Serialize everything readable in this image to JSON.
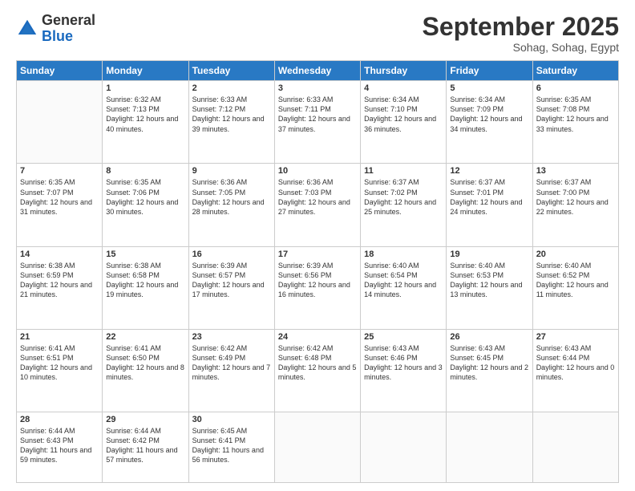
{
  "header": {
    "logo_general": "General",
    "logo_blue": "Blue",
    "month_title": "September 2025",
    "location": "Sohag, Sohag, Egypt"
  },
  "days_of_week": [
    "Sunday",
    "Monday",
    "Tuesday",
    "Wednesday",
    "Thursday",
    "Friday",
    "Saturday"
  ],
  "weeks": [
    [
      {
        "day": "",
        "sunrise": "",
        "sunset": "",
        "daylight": ""
      },
      {
        "day": "1",
        "sunrise": "Sunrise: 6:32 AM",
        "sunset": "Sunset: 7:13 PM",
        "daylight": "Daylight: 12 hours and 40 minutes."
      },
      {
        "day": "2",
        "sunrise": "Sunrise: 6:33 AM",
        "sunset": "Sunset: 7:12 PM",
        "daylight": "Daylight: 12 hours and 39 minutes."
      },
      {
        "day": "3",
        "sunrise": "Sunrise: 6:33 AM",
        "sunset": "Sunset: 7:11 PM",
        "daylight": "Daylight: 12 hours and 37 minutes."
      },
      {
        "day": "4",
        "sunrise": "Sunrise: 6:34 AM",
        "sunset": "Sunset: 7:10 PM",
        "daylight": "Daylight: 12 hours and 36 minutes."
      },
      {
        "day": "5",
        "sunrise": "Sunrise: 6:34 AM",
        "sunset": "Sunset: 7:09 PM",
        "daylight": "Daylight: 12 hours and 34 minutes."
      },
      {
        "day": "6",
        "sunrise": "Sunrise: 6:35 AM",
        "sunset": "Sunset: 7:08 PM",
        "daylight": "Daylight: 12 hours and 33 minutes."
      }
    ],
    [
      {
        "day": "7",
        "sunrise": "Sunrise: 6:35 AM",
        "sunset": "Sunset: 7:07 PM",
        "daylight": "Daylight: 12 hours and 31 minutes."
      },
      {
        "day": "8",
        "sunrise": "Sunrise: 6:35 AM",
        "sunset": "Sunset: 7:06 PM",
        "daylight": "Daylight: 12 hours and 30 minutes."
      },
      {
        "day": "9",
        "sunrise": "Sunrise: 6:36 AM",
        "sunset": "Sunset: 7:05 PM",
        "daylight": "Daylight: 12 hours and 28 minutes."
      },
      {
        "day": "10",
        "sunrise": "Sunrise: 6:36 AM",
        "sunset": "Sunset: 7:03 PM",
        "daylight": "Daylight: 12 hours and 27 minutes."
      },
      {
        "day": "11",
        "sunrise": "Sunrise: 6:37 AM",
        "sunset": "Sunset: 7:02 PM",
        "daylight": "Daylight: 12 hours and 25 minutes."
      },
      {
        "day": "12",
        "sunrise": "Sunrise: 6:37 AM",
        "sunset": "Sunset: 7:01 PM",
        "daylight": "Daylight: 12 hours and 24 minutes."
      },
      {
        "day": "13",
        "sunrise": "Sunrise: 6:37 AM",
        "sunset": "Sunset: 7:00 PM",
        "daylight": "Daylight: 12 hours and 22 minutes."
      }
    ],
    [
      {
        "day": "14",
        "sunrise": "Sunrise: 6:38 AM",
        "sunset": "Sunset: 6:59 PM",
        "daylight": "Daylight: 12 hours and 21 minutes."
      },
      {
        "day": "15",
        "sunrise": "Sunrise: 6:38 AM",
        "sunset": "Sunset: 6:58 PM",
        "daylight": "Daylight: 12 hours and 19 minutes."
      },
      {
        "day": "16",
        "sunrise": "Sunrise: 6:39 AM",
        "sunset": "Sunset: 6:57 PM",
        "daylight": "Daylight: 12 hours and 17 minutes."
      },
      {
        "day": "17",
        "sunrise": "Sunrise: 6:39 AM",
        "sunset": "Sunset: 6:56 PM",
        "daylight": "Daylight: 12 hours and 16 minutes."
      },
      {
        "day": "18",
        "sunrise": "Sunrise: 6:40 AM",
        "sunset": "Sunset: 6:54 PM",
        "daylight": "Daylight: 12 hours and 14 minutes."
      },
      {
        "day": "19",
        "sunrise": "Sunrise: 6:40 AM",
        "sunset": "Sunset: 6:53 PM",
        "daylight": "Daylight: 12 hours and 13 minutes."
      },
      {
        "day": "20",
        "sunrise": "Sunrise: 6:40 AM",
        "sunset": "Sunset: 6:52 PM",
        "daylight": "Daylight: 12 hours and 11 minutes."
      }
    ],
    [
      {
        "day": "21",
        "sunrise": "Sunrise: 6:41 AM",
        "sunset": "Sunset: 6:51 PM",
        "daylight": "Daylight: 12 hours and 10 minutes."
      },
      {
        "day": "22",
        "sunrise": "Sunrise: 6:41 AM",
        "sunset": "Sunset: 6:50 PM",
        "daylight": "Daylight: 12 hours and 8 minutes."
      },
      {
        "day": "23",
        "sunrise": "Sunrise: 6:42 AM",
        "sunset": "Sunset: 6:49 PM",
        "daylight": "Daylight: 12 hours and 7 minutes."
      },
      {
        "day": "24",
        "sunrise": "Sunrise: 6:42 AM",
        "sunset": "Sunset: 6:48 PM",
        "daylight": "Daylight: 12 hours and 5 minutes."
      },
      {
        "day": "25",
        "sunrise": "Sunrise: 6:43 AM",
        "sunset": "Sunset: 6:46 PM",
        "daylight": "Daylight: 12 hours and 3 minutes."
      },
      {
        "day": "26",
        "sunrise": "Sunrise: 6:43 AM",
        "sunset": "Sunset: 6:45 PM",
        "daylight": "Daylight: 12 hours and 2 minutes."
      },
      {
        "day": "27",
        "sunrise": "Sunrise: 6:43 AM",
        "sunset": "Sunset: 6:44 PM",
        "daylight": "Daylight: 12 hours and 0 minutes."
      }
    ],
    [
      {
        "day": "28",
        "sunrise": "Sunrise: 6:44 AM",
        "sunset": "Sunset: 6:43 PM",
        "daylight": "Daylight: 11 hours and 59 minutes."
      },
      {
        "day": "29",
        "sunrise": "Sunrise: 6:44 AM",
        "sunset": "Sunset: 6:42 PM",
        "daylight": "Daylight: 11 hours and 57 minutes."
      },
      {
        "day": "30",
        "sunrise": "Sunrise: 6:45 AM",
        "sunset": "Sunset: 6:41 PM",
        "daylight": "Daylight: 11 hours and 56 minutes."
      },
      {
        "day": "",
        "sunrise": "",
        "sunset": "",
        "daylight": ""
      },
      {
        "day": "",
        "sunrise": "",
        "sunset": "",
        "daylight": ""
      },
      {
        "day": "",
        "sunrise": "",
        "sunset": "",
        "daylight": ""
      },
      {
        "day": "",
        "sunrise": "",
        "sunset": "",
        "daylight": ""
      }
    ]
  ]
}
